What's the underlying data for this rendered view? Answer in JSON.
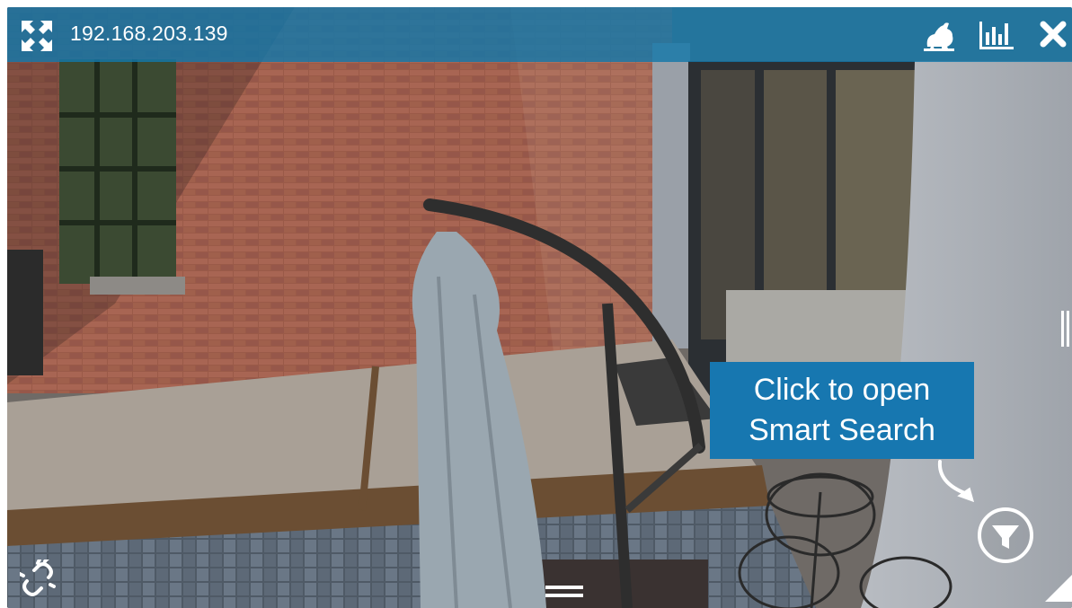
{
  "camera": {
    "title": "192.168.203.139"
  },
  "toolbar": {
    "icons": [
      "expand-icon",
      "rabbit-icon",
      "stats-icon",
      "close-icon"
    ]
  },
  "callout": {
    "line1": "Click to open",
    "line2": "Smart Search"
  },
  "controls": {
    "icons": [
      "link-icon",
      "menu-icon",
      "smart-search-filter-icon",
      "side-handle",
      "resize-handle"
    ]
  },
  "colors": {
    "toolbar_bg": "#1478aa",
    "callout_bg": "#1777b0",
    "icon": "#ffffff"
  }
}
